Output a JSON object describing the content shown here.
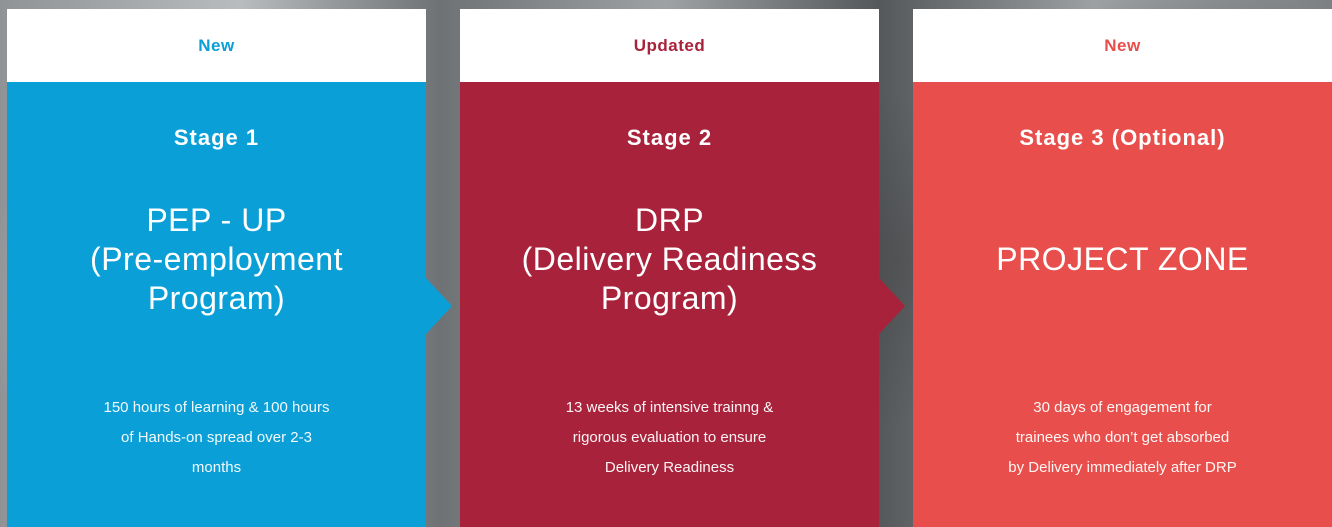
{
  "colors": {
    "stage1": "#0a9fd6",
    "stage2": "#a9223b",
    "stage3": "#e84e4b"
  },
  "cards": [
    {
      "tag": "New",
      "stage": "Stage 1",
      "title_lines": [
        "PEP - UP",
        "(Pre-employment",
        "Program)"
      ],
      "desc_lines": [
        "150 hours of learning & 100 hours",
        "of Hands-on spread over 2-3",
        "months"
      ]
    },
    {
      "tag": "Updated",
      "stage": "Stage 2",
      "title_lines": [
        "DRP",
        "(Delivery Readiness",
        "Program)"
      ],
      "desc_lines": [
        "13 weeks of intensive trainng &",
        "rigorous evaluation to ensure",
        "Delivery Readiness"
      ]
    },
    {
      "tag": "New",
      "stage": "Stage 3 (Optional)",
      "title_lines": [
        "PROJECT ZONE"
      ],
      "desc_lines": [
        "30 days of engagement for",
        "trainees who don’t get absorbed",
        "by Delivery immediately after DRP"
      ]
    }
  ]
}
